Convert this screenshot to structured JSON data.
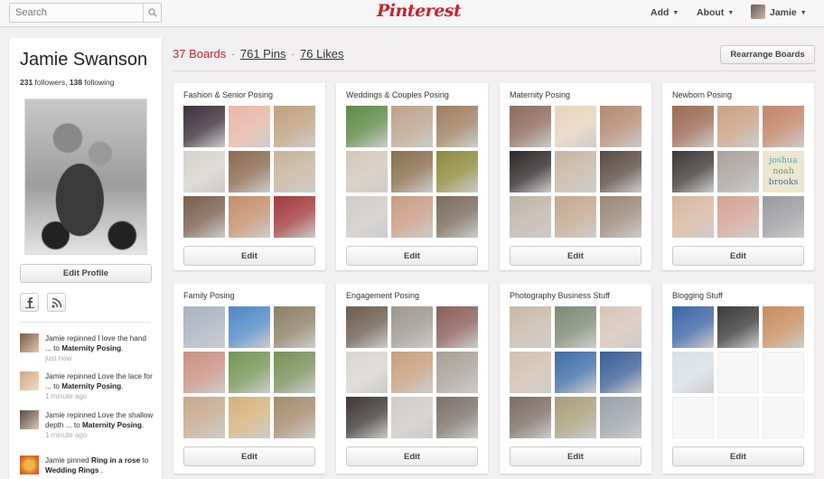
{
  "header": {
    "search_placeholder": "Search",
    "logo": "Pinterest",
    "nav": [
      {
        "label": "Add",
        "caret": "▼"
      },
      {
        "label": "About",
        "caret": "▼"
      },
      {
        "label": "Jamie",
        "caret": "▼"
      }
    ]
  },
  "profile": {
    "name": "Jamie Swanson",
    "followers_count": "231",
    "followers_label": " followers, ",
    "following_count": "138",
    "following_label": " following",
    "edit_label": "Edit Profile",
    "social_icons": [
      "facebook-icon",
      "rss-icon"
    ]
  },
  "activity": [
    {
      "pre": "Jamie repinned I love the hand ... to ",
      "board": "Maternity Posing",
      "post": ".",
      "time": "just now"
    },
    {
      "pre": "Jamie repinned Love the lace for ... to ",
      "board": "Maternity Posing",
      "post": ".",
      "time": "1 minute ago"
    },
    {
      "pre": "Jamie repinned Love the shallow depth ... to ",
      "board": "Maternity Posing",
      "post": ".",
      "time": "1 minute ago"
    },
    {
      "pre": "Jamie pinned ",
      "board": "Ring in a rose",
      "mid": " to ",
      "board2": "Wedding Rings",
      "post": " .",
      "time": ""
    }
  ],
  "stats": {
    "boards": "37 Boards",
    "sep": "·",
    "pins": "761 Pins",
    "likes": "76 Likes"
  },
  "rearrange_label": "Rearrange Boards",
  "boards": [
    {
      "title": "Fashion & Senior Posing",
      "edit": "Edit"
    },
    {
      "title": "Weddings & Couples Posing",
      "edit": "Edit"
    },
    {
      "title": "Maternity Posing",
      "edit": "Edit"
    },
    {
      "title": "Newborn Posing",
      "edit": "Edit"
    },
    {
      "title": "Family Posing",
      "edit": "Edit"
    },
    {
      "title": "Engagement Posing",
      "edit": "Edit"
    },
    {
      "title": "Photography Business Stuff",
      "edit": "Edit"
    },
    {
      "title": "Blogging Stuff",
      "edit": "Edit"
    }
  ],
  "newborn_tile_text": [
    "joshua",
    "noah",
    "brooks"
  ],
  "colors": {
    "brand": "#c8232c",
    "background": "#f2f0f0"
  }
}
